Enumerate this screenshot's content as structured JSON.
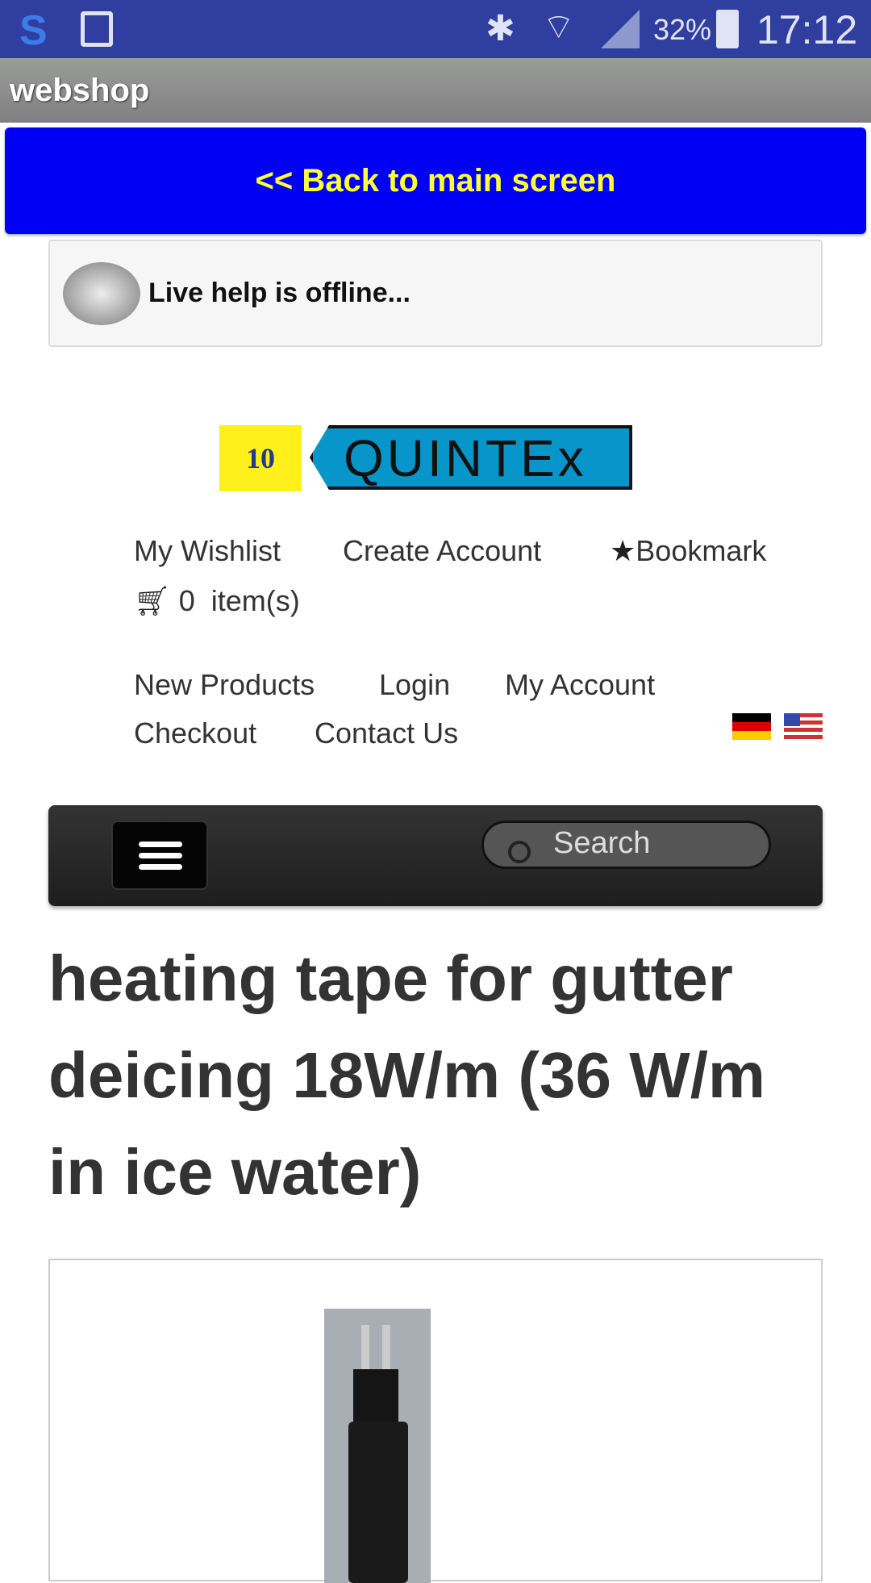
{
  "status_bar": {
    "battery": "32%",
    "time": "17:12",
    "icons": [
      "s-app-icon",
      "gallery-icon",
      "bluetooth-icon",
      "wifi-icon",
      "signal-icon",
      "battery-charging-icon"
    ]
  },
  "app_bar": {
    "title": "webshop"
  },
  "back_button": {
    "label": "<< Back to main screen"
  },
  "live_help": {
    "text": "Live help is offline..."
  },
  "logo": {
    "brand": "QUINTEx",
    "badge": "10"
  },
  "links_top": {
    "wishlist": "My Wishlist",
    "create_account": "Create Account",
    "bookmark": "Bookmark",
    "cart_count": "0",
    "cart_label": "item(s)"
  },
  "nav": {
    "new_products": "New Products",
    "login": "Login",
    "my_account": "My Account",
    "checkout": "Checkout",
    "contact": "Contact Us"
  },
  "languages": [
    "German",
    "English (US)"
  ],
  "search": {
    "placeholder": "Search"
  },
  "product": {
    "title": "heating tape for gutter deicing 18W/m (36 W/m in ice water)"
  },
  "colors": {
    "status_bar": "#303f9f",
    "back_button": "#0000f5",
    "back_text": "#ffff33"
  }
}
